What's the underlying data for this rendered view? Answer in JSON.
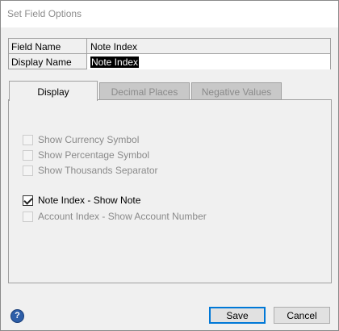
{
  "window": {
    "title": "Set Field Options"
  },
  "fields": {
    "field_name_label": "Field Name",
    "field_name_value": "Note Index",
    "display_name_label": "Display Name",
    "display_name_value": "Note Index"
  },
  "tabs": [
    {
      "label": "Display",
      "active": true
    },
    {
      "label": "Decimal Places",
      "active": false
    },
    {
      "label": "Negative Values",
      "active": false
    }
  ],
  "options": [
    {
      "label": "Show Currency Symbol",
      "checked": false,
      "enabled": false
    },
    {
      "label": "Show Percentage Symbol",
      "checked": false,
      "enabled": false
    },
    {
      "label": "Show Thousands Separator",
      "checked": false,
      "enabled": false
    },
    {
      "label": "Note Index - Show Note",
      "checked": true,
      "enabled": true
    },
    {
      "label": "Account Index - Show Account Number",
      "checked": false,
      "enabled": false
    }
  ],
  "footer": {
    "help_icon": "help-icon",
    "save_label": "Save",
    "cancel_label": "Cancel"
  }
}
